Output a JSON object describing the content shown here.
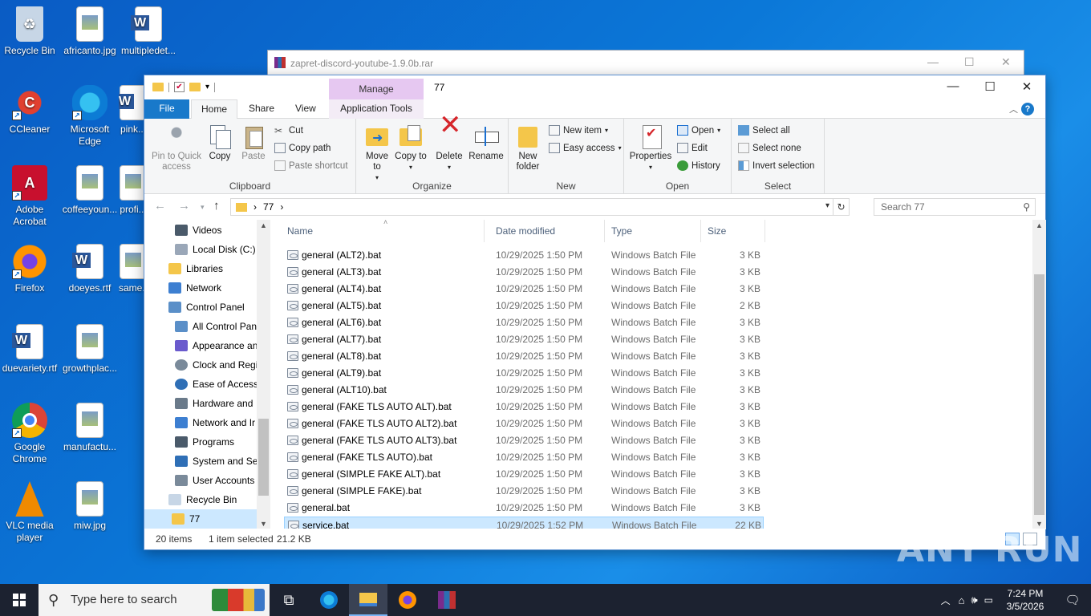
{
  "desktop": {
    "icons": [
      {
        "label": "Recycle Bin"
      },
      {
        "label": "africanto.jpg"
      },
      {
        "label": "multipledet..."
      },
      {
        "label": "CCleaner"
      },
      {
        "label": "Microsoft Edge"
      },
      {
        "label": "pink..."
      },
      {
        "label": "Adobe Acrobat"
      },
      {
        "label": "coffeeyoun..."
      },
      {
        "label": "profi..."
      },
      {
        "label": "Firefox"
      },
      {
        "label": "doeyes.rtf"
      },
      {
        "label": "same..."
      },
      {
        "label": "duevariety.rtf"
      },
      {
        "label": "growthplac..."
      },
      {
        "label": "Google Chrome"
      },
      {
        "label": "manufactu..."
      },
      {
        "label": "VLC media player"
      },
      {
        "label": "miw.jpg"
      }
    ]
  },
  "rar_window": {
    "title": "zapret-discord-youtube-1.9.0b.rar"
  },
  "explorer": {
    "title": "77",
    "manage_tab": "Manage",
    "tabs": {
      "file": "File",
      "home": "Home",
      "share": "Share",
      "view": "View",
      "app_tools": "Application Tools"
    },
    "ribbon": {
      "clipboard": {
        "label": "Clipboard",
        "pin_quick_access": "Pin to Quick access",
        "copy": "Copy",
        "paste": "Paste",
        "cut": "Cut",
        "copy_path": "Copy path",
        "paste_shortcut": "Paste shortcut"
      },
      "organize": {
        "label": "Organize",
        "move_to": "Move to",
        "copy_to": "Copy to",
        "delete": "Delete",
        "rename": "Rename"
      },
      "new": {
        "label": "New",
        "new_folder": "New folder",
        "new_item": "New item",
        "easy_access": "Easy access"
      },
      "open": {
        "label": "Open",
        "properties": "Properties",
        "open": "Open",
        "edit": "Edit",
        "history": "History"
      },
      "select": {
        "label": "Select",
        "select_all": "Select all",
        "select_none": "Select none",
        "invert_selection": "Invert selection"
      }
    },
    "address": {
      "path": "77"
    },
    "search": {
      "placeholder": "Search 77"
    },
    "nav": [
      {
        "label": "Videos"
      },
      {
        "label": "Local Disk (C:)"
      },
      {
        "label": "Libraries"
      },
      {
        "label": "Network"
      },
      {
        "label": "Control Panel"
      },
      {
        "label": "All Control Pan"
      },
      {
        "label": "Appearance an"
      },
      {
        "label": "Clock and Regi"
      },
      {
        "label": "Ease of Access"
      },
      {
        "label": "Hardware and"
      },
      {
        "label": "Network and Ir"
      },
      {
        "label": "Programs"
      },
      {
        "label": "System and Se"
      },
      {
        "label": "User Accounts"
      },
      {
        "label": "Recycle Bin"
      },
      {
        "label": "77"
      }
    ],
    "columns": {
      "name": "Name",
      "date": "Date modified",
      "type": "Type",
      "size": "Size"
    },
    "files": [
      {
        "name": "general (ALT2).bat",
        "date": "10/29/2025 1:50 PM",
        "type": "Windows Batch File",
        "size": "3 KB"
      },
      {
        "name": "general (ALT3).bat",
        "date": "10/29/2025 1:50 PM",
        "type": "Windows Batch File",
        "size": "3 KB"
      },
      {
        "name": "general (ALT4).bat",
        "date": "10/29/2025 1:50 PM",
        "type": "Windows Batch File",
        "size": "3 KB"
      },
      {
        "name": "general (ALT5).bat",
        "date": "10/29/2025 1:50 PM",
        "type": "Windows Batch File",
        "size": "2 KB"
      },
      {
        "name": "general (ALT6).bat",
        "date": "10/29/2025 1:50 PM",
        "type": "Windows Batch File",
        "size": "3 KB"
      },
      {
        "name": "general (ALT7).bat",
        "date": "10/29/2025 1:50 PM",
        "type": "Windows Batch File",
        "size": "3 KB"
      },
      {
        "name": "general (ALT8).bat",
        "date": "10/29/2025 1:50 PM",
        "type": "Windows Batch File",
        "size": "3 KB"
      },
      {
        "name": "general (ALT9).bat",
        "date": "10/29/2025 1:50 PM",
        "type": "Windows Batch File",
        "size": "3 KB"
      },
      {
        "name": "general (ALT10).bat",
        "date": "10/29/2025 1:50 PM",
        "type": "Windows Batch File",
        "size": "3 KB"
      },
      {
        "name": "general (FAKE TLS AUTO ALT).bat",
        "date": "10/29/2025 1:50 PM",
        "type": "Windows Batch File",
        "size": "3 KB"
      },
      {
        "name": "general (FAKE TLS AUTO ALT2).bat",
        "date": "10/29/2025 1:50 PM",
        "type": "Windows Batch File",
        "size": "3 KB"
      },
      {
        "name": "general (FAKE TLS AUTO ALT3).bat",
        "date": "10/29/2025 1:50 PM",
        "type": "Windows Batch File",
        "size": "3 KB"
      },
      {
        "name": "general (FAKE TLS AUTO).bat",
        "date": "10/29/2025 1:50 PM",
        "type": "Windows Batch File",
        "size": "3 KB"
      },
      {
        "name": "general (SIMPLE FAKE ALT).bat",
        "date": "10/29/2025 1:50 PM",
        "type": "Windows Batch File",
        "size": "3 KB"
      },
      {
        "name": "general (SIMPLE FAKE).bat",
        "date": "10/29/2025 1:50 PM",
        "type": "Windows Batch File",
        "size": "3 KB"
      },
      {
        "name": "general.bat",
        "date": "10/29/2025 1:50 PM",
        "type": "Windows Batch File",
        "size": "3 KB"
      },
      {
        "name": "service.bat",
        "date": "10/29/2025 1:52 PM",
        "type": "Windows Batch File",
        "size": "22 KB",
        "selected": true
      }
    ],
    "status": {
      "count": "20 items",
      "selected": "1 item selected",
      "size": "21.2 KB"
    }
  },
  "taskbar": {
    "search_placeholder": "Type here to search",
    "time": "7:24 PM",
    "date": "3/5/2026"
  },
  "watermark": "ANY RUN",
  "colors": {
    "accent": "#1979ca",
    "selection": "#cce8ff",
    "manage": "#e6c8f1",
    "taskbar": "#1c2230"
  }
}
